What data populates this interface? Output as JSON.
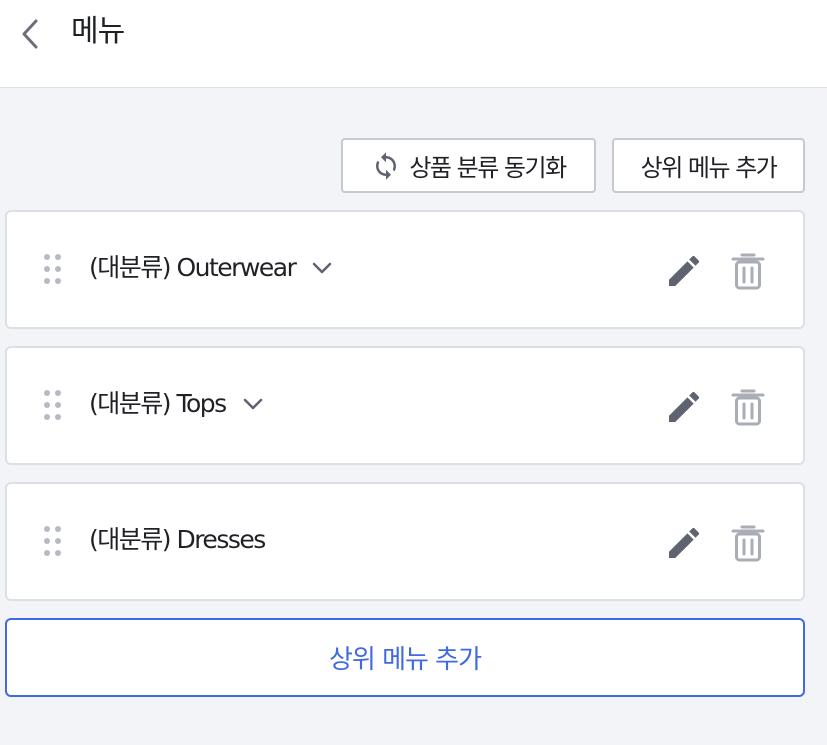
{
  "header": {
    "title": "메뉴",
    "back_icon": "chevron-left-icon"
  },
  "toolbar": {
    "sync_label": "상품 분류 동기화",
    "sync_icon": "refresh-icon",
    "add_top_label": "상위 메뉴 추가"
  },
  "menu_items": [
    {
      "label": "(대분류) Outerwear",
      "expandable": true
    },
    {
      "label": "(대분류) Tops",
      "expandable": true
    },
    {
      "label": "(대분류) Dresses",
      "expandable": false
    }
  ],
  "icons": {
    "drag": "drag-handle-icon",
    "edit": "pencil-icon",
    "delete": "trash-icon",
    "expand": "chevron-down-icon"
  },
  "bottom": {
    "add_top_label": "상위 메뉴 추가"
  },
  "colors": {
    "accent": "#3f6ae0",
    "background": "#f3f4f7",
    "icon_dark": "#5f6370",
    "icon_light": "#a9adb6"
  }
}
